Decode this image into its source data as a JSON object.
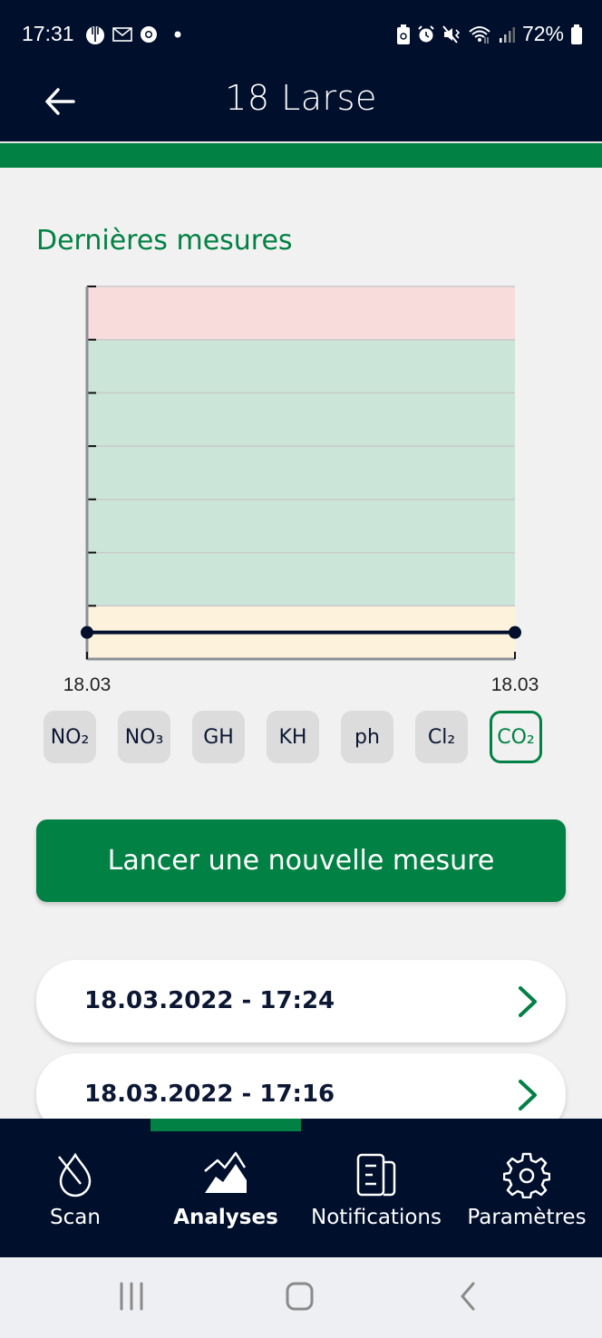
{
  "status_bar": {
    "time": "17:31",
    "left_icons": [
      "hand-icon",
      "mail-icon",
      "chrome-icon",
      "dot-icon"
    ],
    "right_icons": [
      "battery-saver-icon",
      "alarm-icon",
      "vibrate-icon",
      "wifi-icon",
      "signal-icon"
    ],
    "battery": "72%"
  },
  "header": {
    "title": "18 Larse",
    "back_icon": "arrow-left-icon"
  },
  "section": {
    "title": "Dernières mesures"
  },
  "chart_data": {
    "type": "line",
    "title": "",
    "xlabel": "",
    "ylabel": "",
    "x": [
      "18.03",
      "18.03"
    ],
    "series": [
      {
        "name": "CO2",
        "values": [
          0.5,
          0.5
        ]
      }
    ],
    "ylim": [
      0,
      7
    ],
    "yticks": [
      0,
      1,
      2,
      3,
      4,
      5,
      6,
      7
    ],
    "ytick_labels_shown": false,
    "grid": true,
    "bands": [
      {
        "from": 0,
        "to": 1,
        "color": "#fdf2db",
        "meaning": "low"
      },
      {
        "from": 1,
        "to": 6,
        "color": "#cce5d9",
        "meaning": "ok"
      },
      {
        "from": 6,
        "to": 7,
        "color": "#f8dcdc",
        "meaning": "high"
      }
    ],
    "line_color": "#000f2c",
    "x_tick_labels": [
      "18.03",
      "18.03"
    ]
  },
  "parameters": {
    "options": [
      {
        "label": "NO₂",
        "active": false
      },
      {
        "label": "NO₃",
        "active": false
      },
      {
        "label": "GH",
        "active": false
      },
      {
        "label": "KH",
        "active": false
      },
      {
        "label": "ph",
        "active": false
      },
      {
        "label": "Cl₂",
        "active": false
      },
      {
        "label": "CO₂",
        "active": true
      }
    ]
  },
  "actions": {
    "new_measure_label": "Lancer une nouvelle mesure"
  },
  "measurements": [
    {
      "label": "18.03.2022 - 17:24"
    },
    {
      "label": "18.03.2022 - 17:16"
    }
  ],
  "bottom_nav": {
    "items": [
      {
        "label": "Scan",
        "icon": "drop-scan-icon",
        "active": false
      },
      {
        "label": "Analyses",
        "icon": "chart-mountain-icon",
        "active": true
      },
      {
        "label": "Notifications",
        "icon": "document-icon",
        "active": false
      },
      {
        "label": "Paramètres",
        "icon": "gear-icon",
        "active": false
      }
    ]
  },
  "colors": {
    "primary_green": "#018143",
    "navy": "#000f2c",
    "background": "#f1f1f1"
  }
}
